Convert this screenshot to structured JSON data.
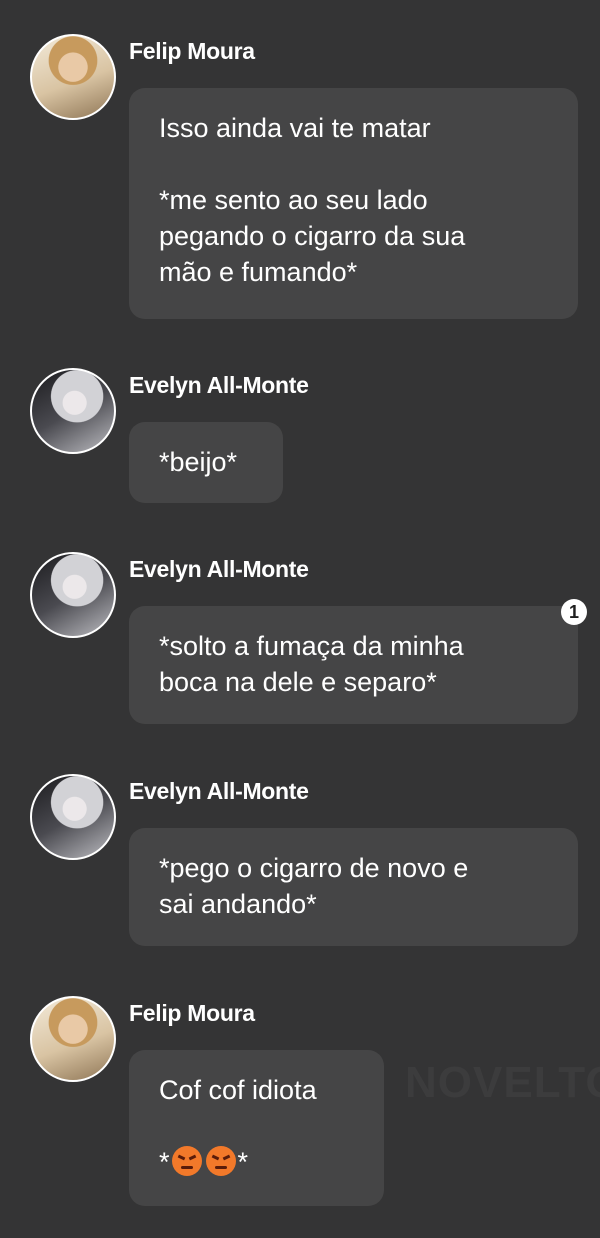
{
  "messages": [
    {
      "sender": "Felip Moura",
      "avatar": "felip-avatar",
      "lines": [
        "Isso ainda vai te matar",
        "",
        "*me sento ao seu lado",
        "pegando o cigarro da sua",
        "mão e fumando*"
      ]
    },
    {
      "sender": "Evelyn All-Monte",
      "avatar": "evelyn-avatar",
      "lines": [
        "*beijo*"
      ]
    },
    {
      "sender": "Evelyn All-Monte",
      "avatar": "evelyn-avatar",
      "badge": "1",
      "lines": [
        "*solto a fumaça da minha",
        "boca na dele e separo*"
      ]
    },
    {
      "sender": "Evelyn All-Monte",
      "avatar": "evelyn-avatar",
      "lines": [
        "*pego o cigarro de novo e",
        "sai andando*"
      ]
    },
    {
      "sender": "Felip Moura",
      "avatar": "felip-avatar",
      "lines": [
        "Cof cof idiota",
        ""
      ],
      "emoji_line": {
        "prefix": "*",
        "emoji": [
          "angry-face-icon",
          "angry-face-icon"
        ],
        "suffix": "*"
      }
    }
  ],
  "watermark": "NOVELTO"
}
